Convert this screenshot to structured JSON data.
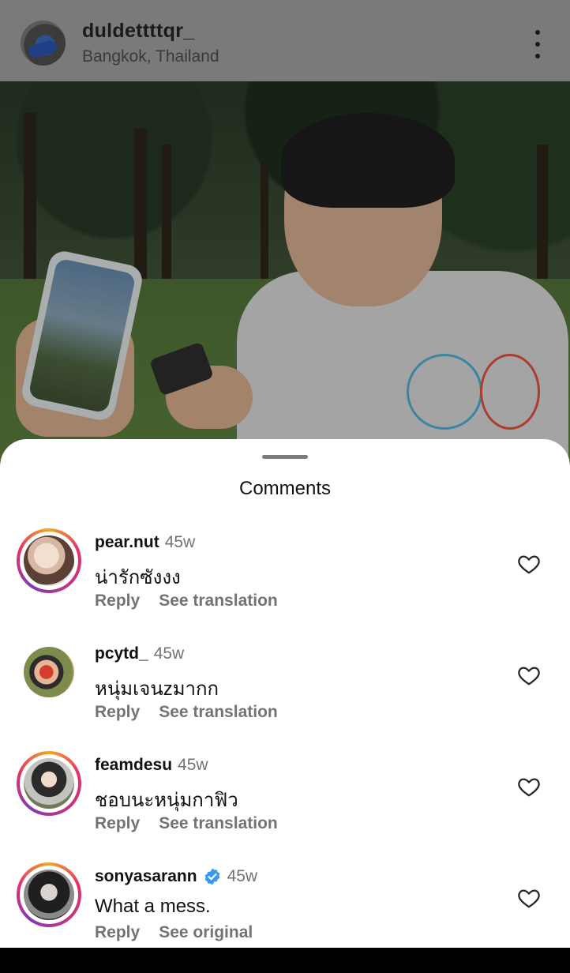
{
  "post_header": {
    "username": "duldettttqr_",
    "location": "Bangkok, Thailand"
  },
  "comments_sheet": {
    "title": "Comments",
    "comments": [
      {
        "username": "pear.nut",
        "time": "45w",
        "text": "น่ารักซังงง",
        "reply_label": "Reply",
        "translate_label": "See translation",
        "verified": false,
        "story_ring": true
      },
      {
        "username": "pcytd_",
        "time": "45w",
        "text": "หนุ่มเจนzมากก",
        "reply_label": "Reply",
        "translate_label": "See translation",
        "verified": false,
        "story_ring": false
      },
      {
        "username": "feamdesu",
        "time": "45w",
        "text": "ชอบนะหนุ่มกาฟิว",
        "reply_label": "Reply",
        "translate_label": "See translation",
        "verified": false,
        "story_ring": true
      },
      {
        "username": "sonyasarann",
        "time": "45w",
        "text": "What a mess.",
        "reply_label": "Reply",
        "translate_label": "See original",
        "verified": true,
        "story_ring": true
      }
    ]
  },
  "colors": {
    "story_ring_start": "#f5a623",
    "story_ring_end": "#c13584",
    "verified_blue": "#3897f0",
    "secondary_text": "#737373"
  }
}
